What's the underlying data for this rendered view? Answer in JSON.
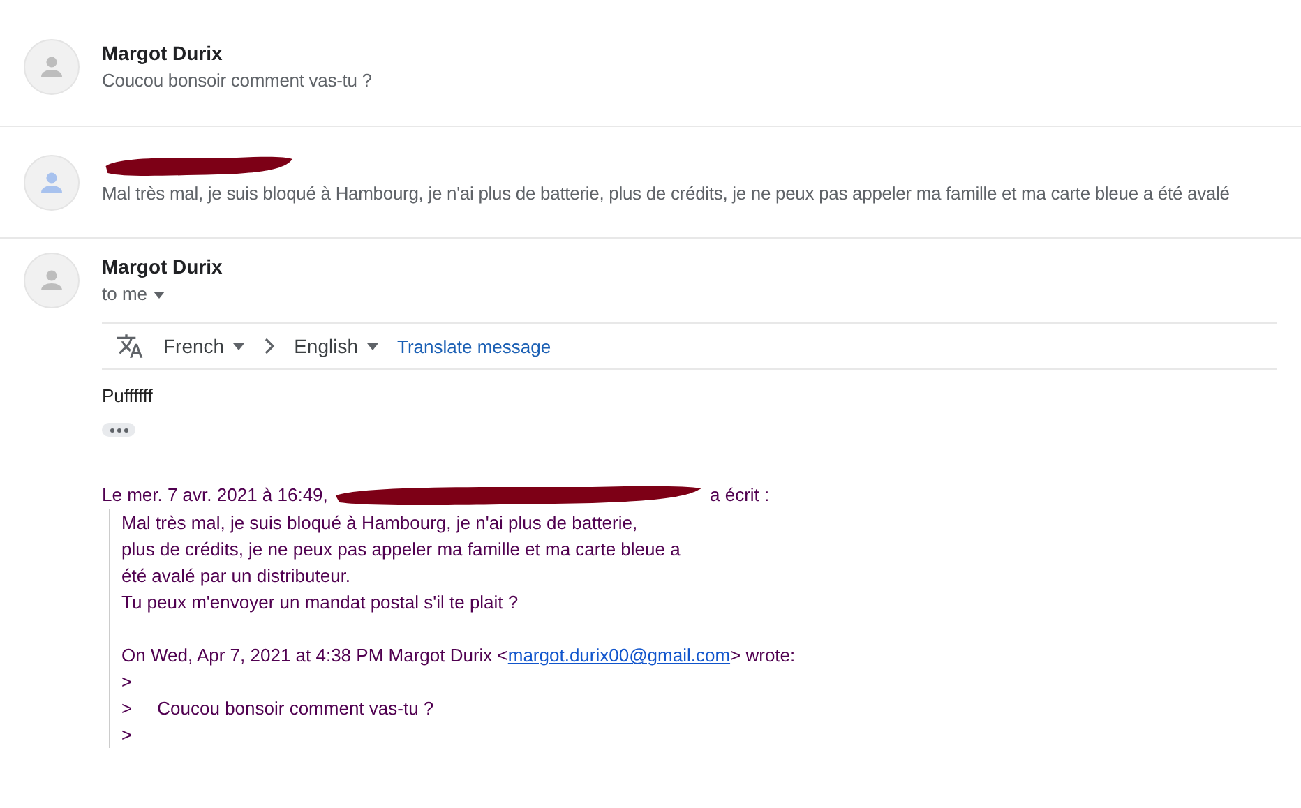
{
  "messages": [
    {
      "kind": "collapsed",
      "sender": "Margot Durix",
      "color": "#bdbdbd",
      "snippet": "Coucou bonsoir comment vas-tu ?"
    },
    {
      "kind": "collapsed",
      "redacted": true,
      "color": "#a8c2ee",
      "snippet": "Mal très mal, je suis bloqué à Hambourg, je n'ai plus de batterie, plus de crédits, je ne peux pas appeler ma famille et ma carte bleue a été avalé"
    },
    {
      "kind": "expanded",
      "sender": "Margot Durix",
      "color": "#bdbdbd",
      "recipient": "to me",
      "translate": {
        "source": "French",
        "target": "English",
        "action": "Translate message"
      },
      "body": "Puffffff",
      "quote": {
        "header_before": "Le mer. 7 avr. 2021 à 16:49,",
        "redacted": true,
        "header_after": "a écrit :",
        "lines": [
          "Mal très mal, je suis bloqué à Hambourg, je n'ai plus de batterie,",
          "plus de crédits, je ne peux pas appeler ma famille et ma carte bleue a",
          "été avalé par un distributeur.",
          "Tu peux m'envoyer un mandat postal s'il te plait ?"
        ],
        "attribution": {
          "before": "On Wed, Apr 7, 2021 at 4:38 PM Margot Durix <",
          "email": "margot.durix00@gmail.com",
          "after": "> wrote:"
        },
        "quoted": [
          ">",
          ">     Coucou bonsoir comment vas-tu ?",
          ">"
        ]
      }
    }
  ]
}
